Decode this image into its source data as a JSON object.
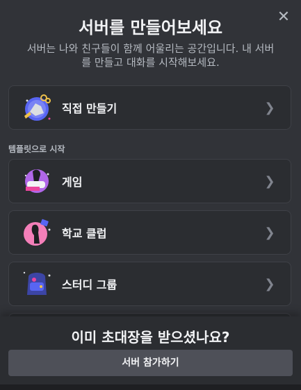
{
  "header": {
    "title": "서버를 만들어보세요",
    "subtitle_line1": "서버는 나와 친구들이 함께 어울리는 공간입니다. 내 서버",
    "subtitle_line2": "를 만들고 대화를 시작해보세요.",
    "close_icon": "close-icon"
  },
  "primary_option": {
    "label": "직접 만들기",
    "icon": "create-own-icon"
  },
  "templates": {
    "section_label": "템플릿으로 시작",
    "items": [
      {
        "label": "게임",
        "icon": "gaming-icon"
      },
      {
        "label": "학교 클럽",
        "icon": "school-club-icon"
      },
      {
        "label": "스터디 그룹",
        "icon": "study-group-icon"
      }
    ]
  },
  "footer": {
    "question": "이미 초대장을 받으셨나요?",
    "join_button": "서버 참가하기"
  },
  "colors": {
    "background": "#313338",
    "card_bg": "#2b2d31",
    "button_bg": "#4e5058",
    "muted_text": "#b5bac1"
  }
}
